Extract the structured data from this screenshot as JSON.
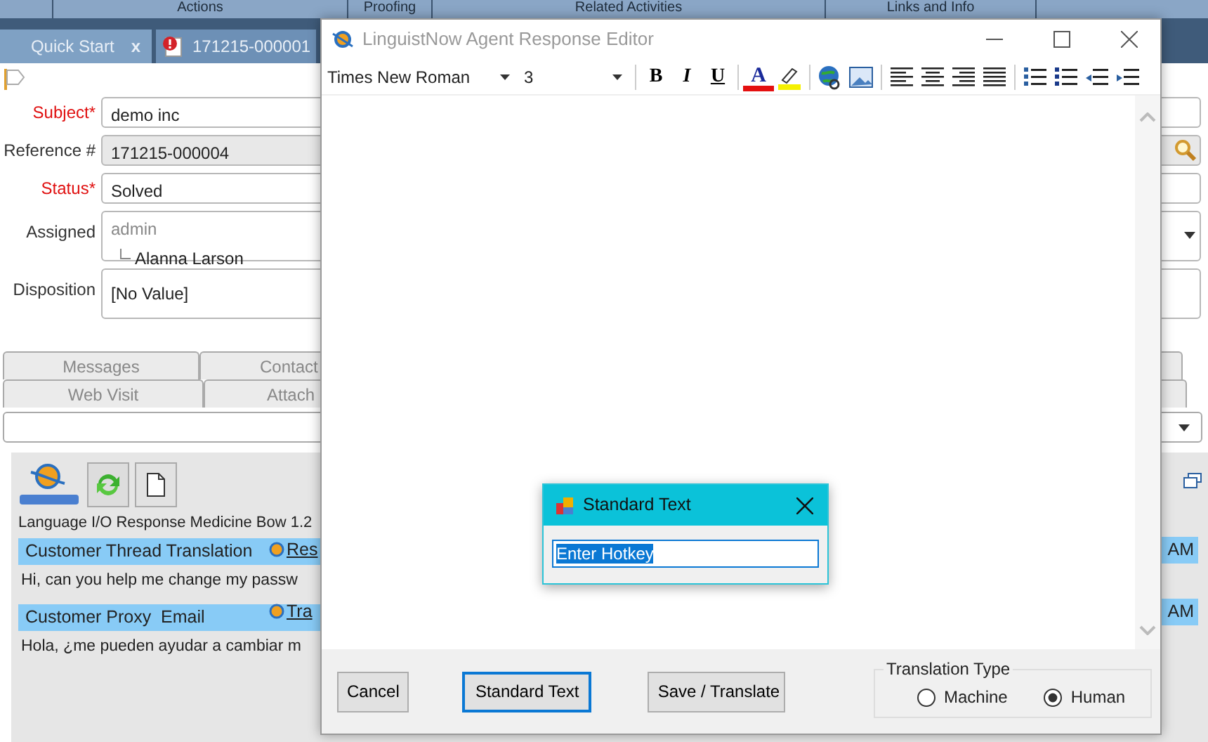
{
  "header_menu": [
    {
      "label": "Actions"
    },
    {
      "label": "Proofing"
    },
    {
      "label": "Related Activities"
    },
    {
      "label": "Links and Info"
    }
  ],
  "tabs": [
    {
      "label": "Quick Start",
      "close": "x",
      "selected": true
    },
    {
      "label": "171215-000001",
      "selected": false
    }
  ],
  "form": [
    {
      "label": "Subject",
      "required": true,
      "required_mark": "*",
      "kind": "text",
      "value": "demo inc"
    },
    {
      "label": "Reference #",
      "required": false,
      "kind": "lookup",
      "disabled": true,
      "value": "171215-000004"
    },
    {
      "label": "Status",
      "required": true,
      "required_mark": "*",
      "kind": "text",
      "value": "Solved"
    },
    {
      "label": "Assigned",
      "required": false,
      "kind": "tree",
      "group": "admin",
      "value": "Alanna Larson"
    },
    {
      "label": "Disposition",
      "required": false,
      "kind": "text",
      "value": "[No Value]"
    }
  ],
  "detail_tabs": [
    [
      {
        "label": "Messages"
      },
      {
        "label": "Contact"
      }
    ],
    [
      {
        "label": "Web Visit"
      },
      {
        "label": "Attach"
      }
    ]
  ],
  "panel": {
    "caption": "Language I/O Response Medicine Bow 1.2",
    "threads": [
      {
        "title": "Customer Thread Translation",
        "link": "Res",
        "time": "AM",
        "body": "Hi, can you help me change my passw"
      },
      {
        "title": "Customer Proxy  Email",
        "link": "Tra",
        "time": "AM",
        "body": "Hola, ¿me pueden ayudar a cambiar m"
      }
    ]
  },
  "editor": {
    "title": "LinguistNow Agent Response Editor",
    "font": "Times New Roman",
    "size": "3",
    "toolbar": [
      {
        "kind": "bold",
        "label": "B"
      },
      {
        "kind": "italic",
        "label": "I"
      },
      {
        "kind": "underline",
        "label": "U"
      },
      {
        "kind": "color",
        "label": "A"
      },
      {
        "kind": "highlight"
      },
      {
        "kind": "link"
      },
      {
        "kind": "image"
      },
      {
        "kind": "align-left"
      },
      {
        "kind": "align-center"
      },
      {
        "kind": "align-right"
      },
      {
        "kind": "justify"
      },
      {
        "kind": "numbered"
      },
      {
        "kind": "bullets"
      },
      {
        "kind": "outdent"
      },
      {
        "kind": "indent"
      }
    ],
    "buttons": [
      {
        "label": "Cancel",
        "default": false
      },
      {
        "label": "Standard Text",
        "default": true
      },
      {
        "label": "Save / Translate",
        "default": false
      }
    ],
    "translation_type": {
      "legend": "Translation Type",
      "options": [
        {
          "label": "Machine",
          "selected": false
        },
        {
          "label": "Human",
          "selected": true
        }
      ]
    }
  },
  "dialog": {
    "title": "Standard Text",
    "value": "Enter Hotkey",
    "text_selected": true
  }
}
